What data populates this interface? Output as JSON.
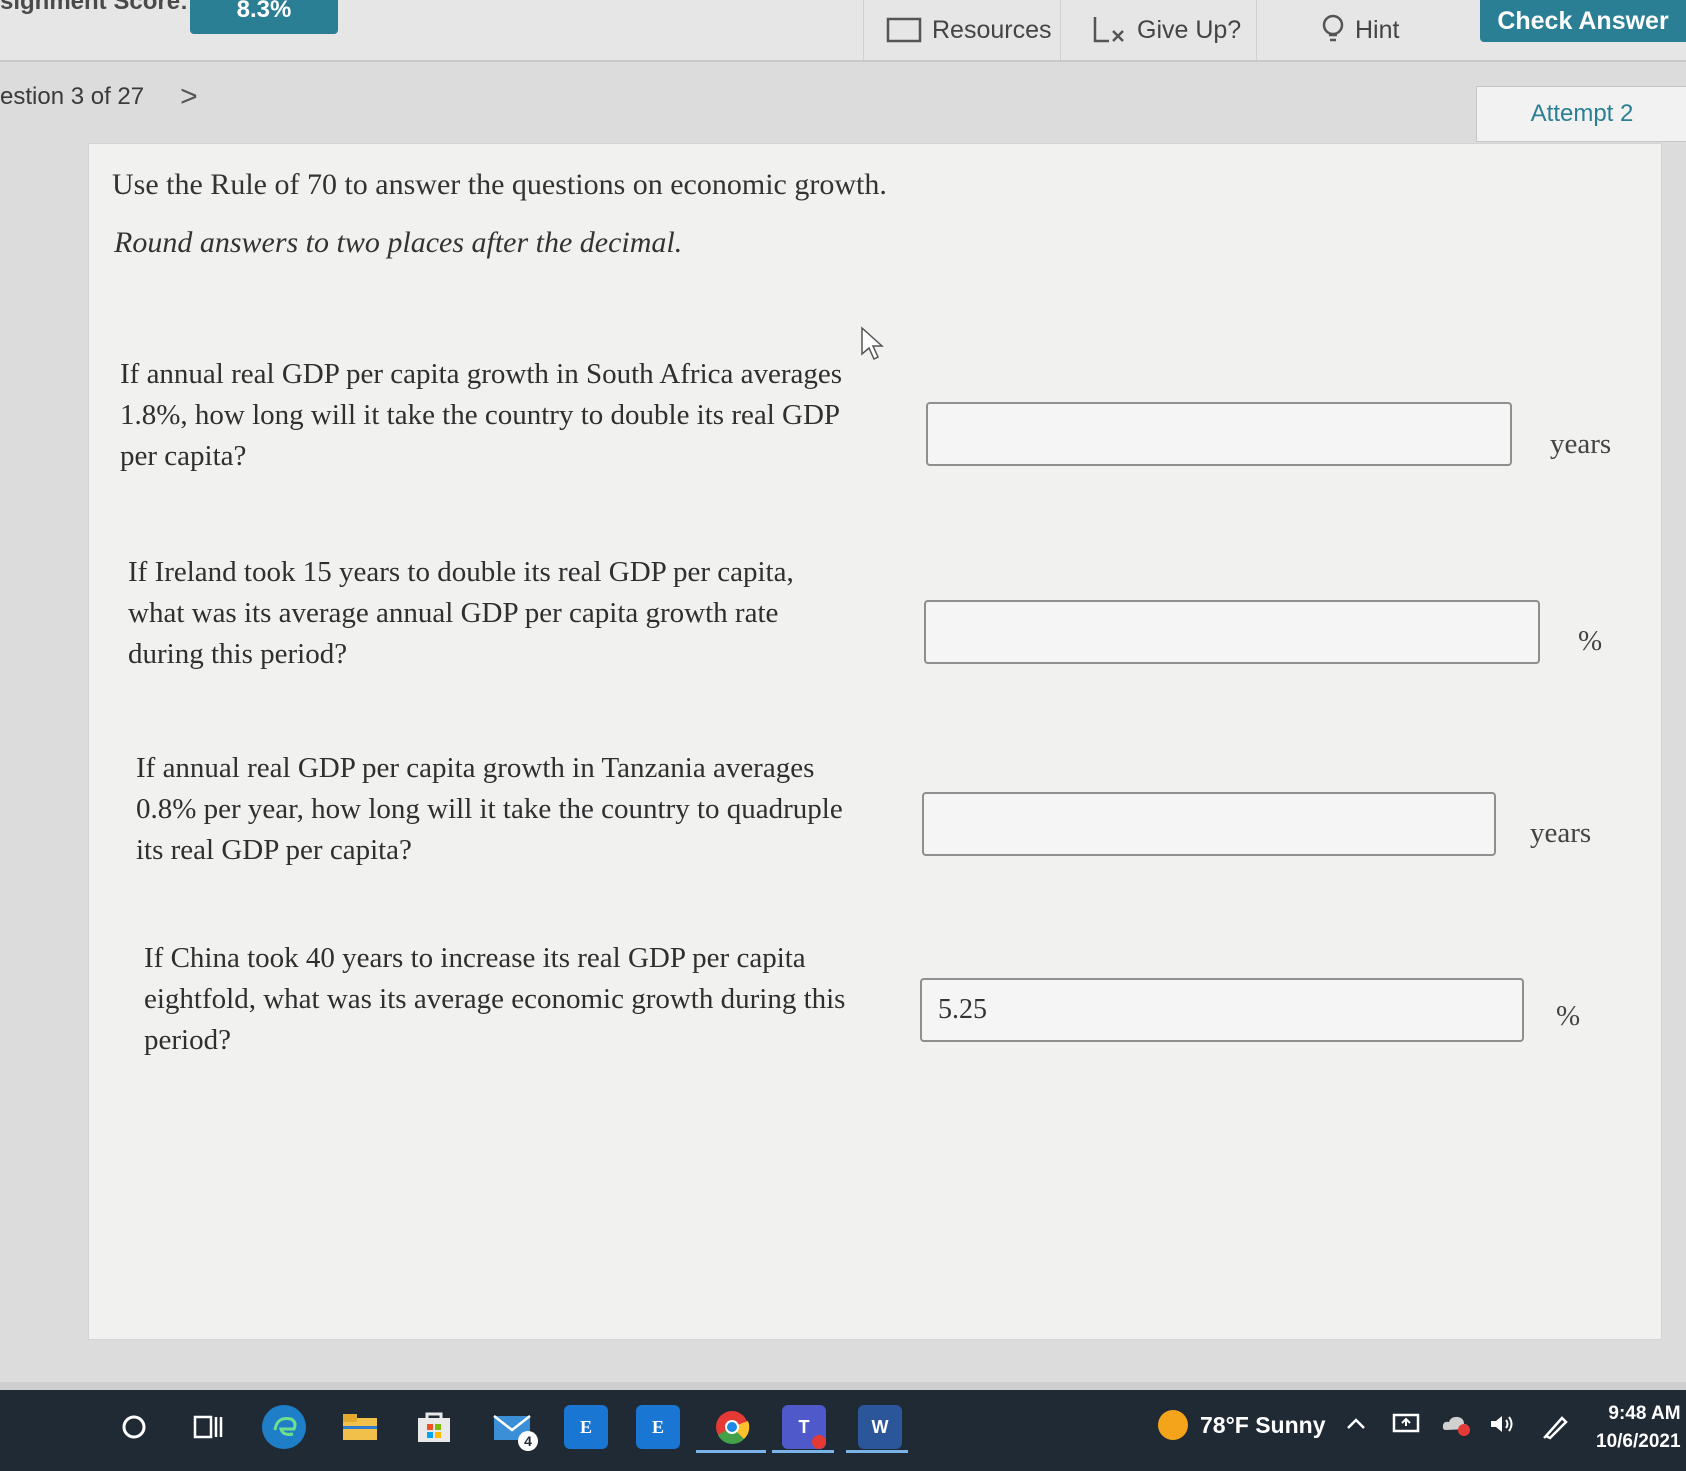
{
  "header": {
    "score_label": "signment Score:",
    "score_value": "8.3%",
    "resources_label": "Resources",
    "giveup_label": "Give Up?",
    "hint_label": "Hint",
    "check_answer_label": "Check Answer"
  },
  "nav": {
    "question_position": "estion 3 of 27",
    "next_arrow": ">",
    "attempt_label": "Attempt 2"
  },
  "content": {
    "intro": "Use the Rule of 70 to answer the questions on economic growth.",
    "instruction": "Round answers to two places after the decimal.",
    "questions": [
      {
        "lines": [
          "If annual real GDP per capita growth in South Africa averages",
          "1.8%, how long will it take the country to double its real GDP",
          "per capita?"
        ],
        "answer": "",
        "unit": "years"
      },
      {
        "lines": [
          "If Ireland took 15 years to double its real GDP per capita,",
          "what was its average annual GDP per capita growth rate",
          "during this period?"
        ],
        "answer": "",
        "unit": "%"
      },
      {
        "lines": [
          "If annual real GDP per capita growth in Tanzania averages",
          "0.8% per year, how long will it take the country to quadruple",
          "its real GDP per capita?"
        ],
        "answer": "",
        "unit": "years"
      },
      {
        "lines": [
          "If China took 40 years to increase its real GDP per capita",
          "eightfold, what was its average economic growth during this",
          "period?"
        ],
        "answer": "5.25",
        "unit": "%"
      }
    ]
  },
  "taskbar": {
    "mail_badge": "4",
    "edge_doc_1": "E",
    "edge_doc_2": "E",
    "word_letter": "W",
    "teams_letter": "T",
    "weather": "78°F  Sunny",
    "time": "9:48 AM",
    "date": "10/6/2021"
  },
  "colors": {
    "accent": "#2b7f94",
    "taskbar": "#1f2a35"
  }
}
